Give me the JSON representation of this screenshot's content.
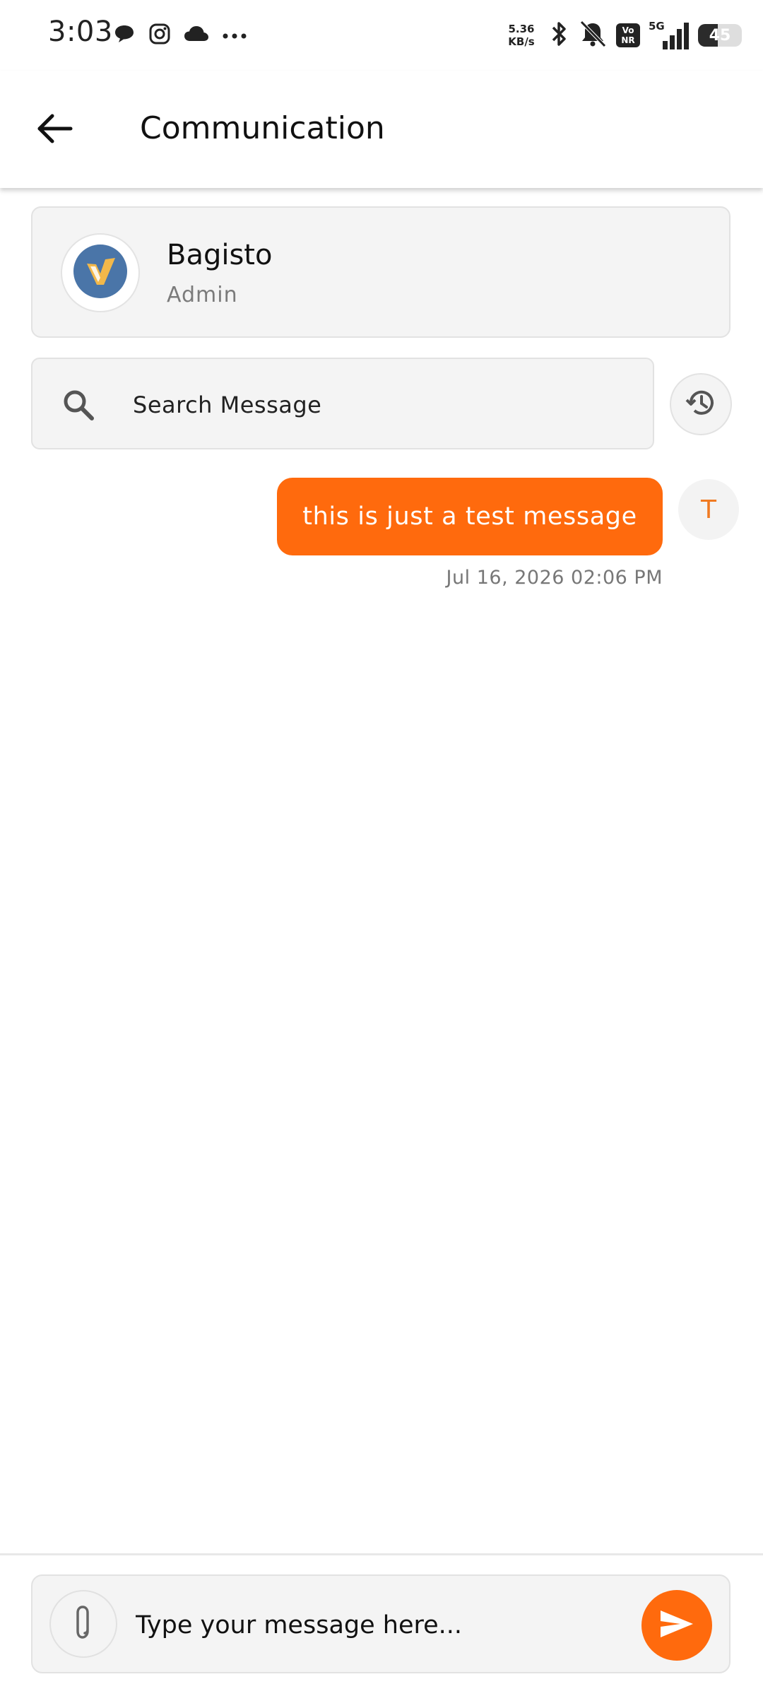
{
  "status_bar": {
    "time": "3:03",
    "left_icons": [
      "message-icon",
      "instagram-icon",
      "cloud-icon",
      "more-icon"
    ],
    "net_speed_value": "5.36",
    "net_speed_unit": "KB/s",
    "network_type": "5G",
    "vo_label_top": "Vo",
    "vo_label_bottom": "NR",
    "battery_level": "45",
    "battery_fraction": 0.45
  },
  "app_bar": {
    "title": "Communication",
    "back_icon": "arrow-left-icon"
  },
  "vendor": {
    "name": "Bagisto",
    "role": "Admin",
    "logo_colors": {
      "background": "#4a75a8",
      "check": "#f2b84a"
    }
  },
  "search": {
    "placeholder": "Search Message",
    "icon": "search-icon",
    "history_icon": "history-icon"
  },
  "messages": [
    {
      "text": "this is just a test message",
      "timestamp": "Jul 16, 2026 02:06 PM",
      "sender_initial": "T"
    }
  ],
  "composer": {
    "placeholder": "Type your message here...",
    "attach_icon": "paperclip-icon",
    "send_icon": "send-icon"
  },
  "colors": {
    "accent": "#ff6a0d",
    "initial_color": "#f07a22",
    "surface": "#f4f4f4"
  }
}
